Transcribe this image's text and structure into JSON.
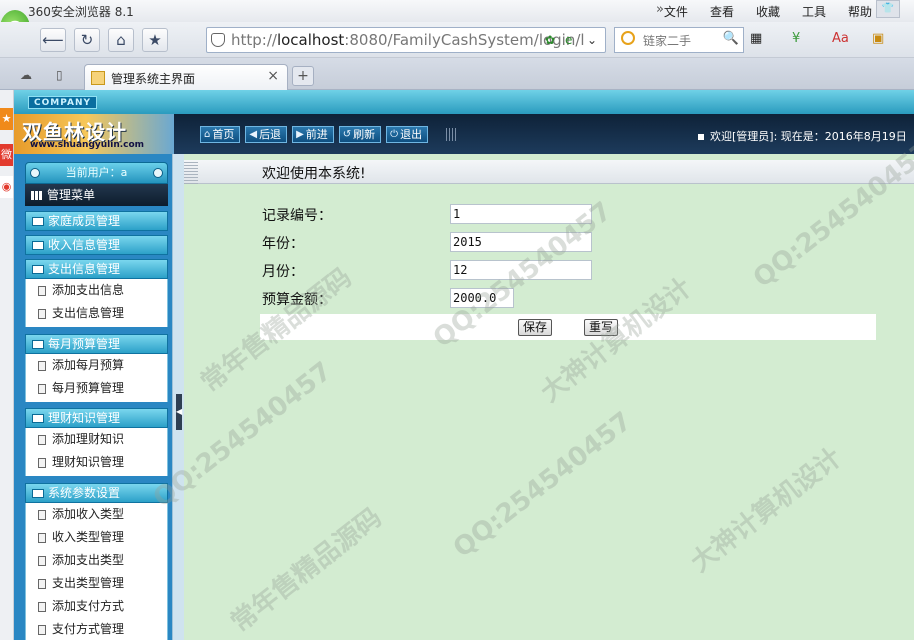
{
  "browser": {
    "app_title": "360安全浏览器 8.1",
    "menus": [
      "文件",
      "查看",
      "收藏",
      "工具",
      "帮助"
    ],
    "url_prefix": "http://",
    "url_host": "localhost",
    "url_rest": ":8080/FamilyCashSystem/login/l",
    "search_placeholder": "链家二手",
    "tab_title": "管理系统主界面",
    "tab_close": "×",
    "new_tab": "+"
  },
  "app": {
    "company_label": "COMPANY",
    "brand_cn": "双鱼林设计",
    "brand_en": "www.shuangyulin.com",
    "header_buttons": [
      {
        "icon": "home-icon",
        "glyph": "⌂",
        "label": "首页"
      },
      {
        "icon": "back-icon",
        "glyph": "◀",
        "label": "后退"
      },
      {
        "icon": "forward-icon",
        "glyph": "▶",
        "label": "前进"
      },
      {
        "icon": "refresh-icon",
        "glyph": "↺",
        "label": "刷新"
      },
      {
        "icon": "logout-icon",
        "glyph": "⏻",
        "label": "退出"
      }
    ],
    "welcome_text": "欢迎[管理员]:  现在是：2016年8月19日"
  },
  "sidebar": {
    "current_user_label": "当前用户：a",
    "menu_title": "管理菜单",
    "groups": [
      {
        "label": "家庭成员管理",
        "items": []
      },
      {
        "label": "收入信息管理",
        "items": []
      },
      {
        "label": "支出信息管理",
        "items": [
          "添加支出信息",
          "支出信息管理"
        ]
      },
      {
        "label": "每月预算管理",
        "items": [
          "添加每月预算",
          "每月预算管理"
        ]
      },
      {
        "label": "理财知识管理",
        "items": [
          "添加理财知识",
          "理财知识管理"
        ]
      },
      {
        "label": "系统参数设置",
        "items": [
          "添加收入类型",
          "收入类型管理",
          "添加支出类型",
          "支出类型管理",
          "添加支付方式",
          "支付方式管理"
        ]
      }
    ]
  },
  "main": {
    "page_title": "欢迎使用本系统!",
    "fields": [
      {
        "label": "记录编号：",
        "value": "1"
      },
      {
        "label": "年份：",
        "value": "2015"
      },
      {
        "label": "月份：",
        "value": "12"
      },
      {
        "label": "预算金额：",
        "value": "2000.0"
      }
    ],
    "save_label": "保存",
    "reset_label": "重写"
  },
  "watermarks": [
    "常年售精品源码",
    "QQ:254540457",
    "大神计算机设计"
  ]
}
